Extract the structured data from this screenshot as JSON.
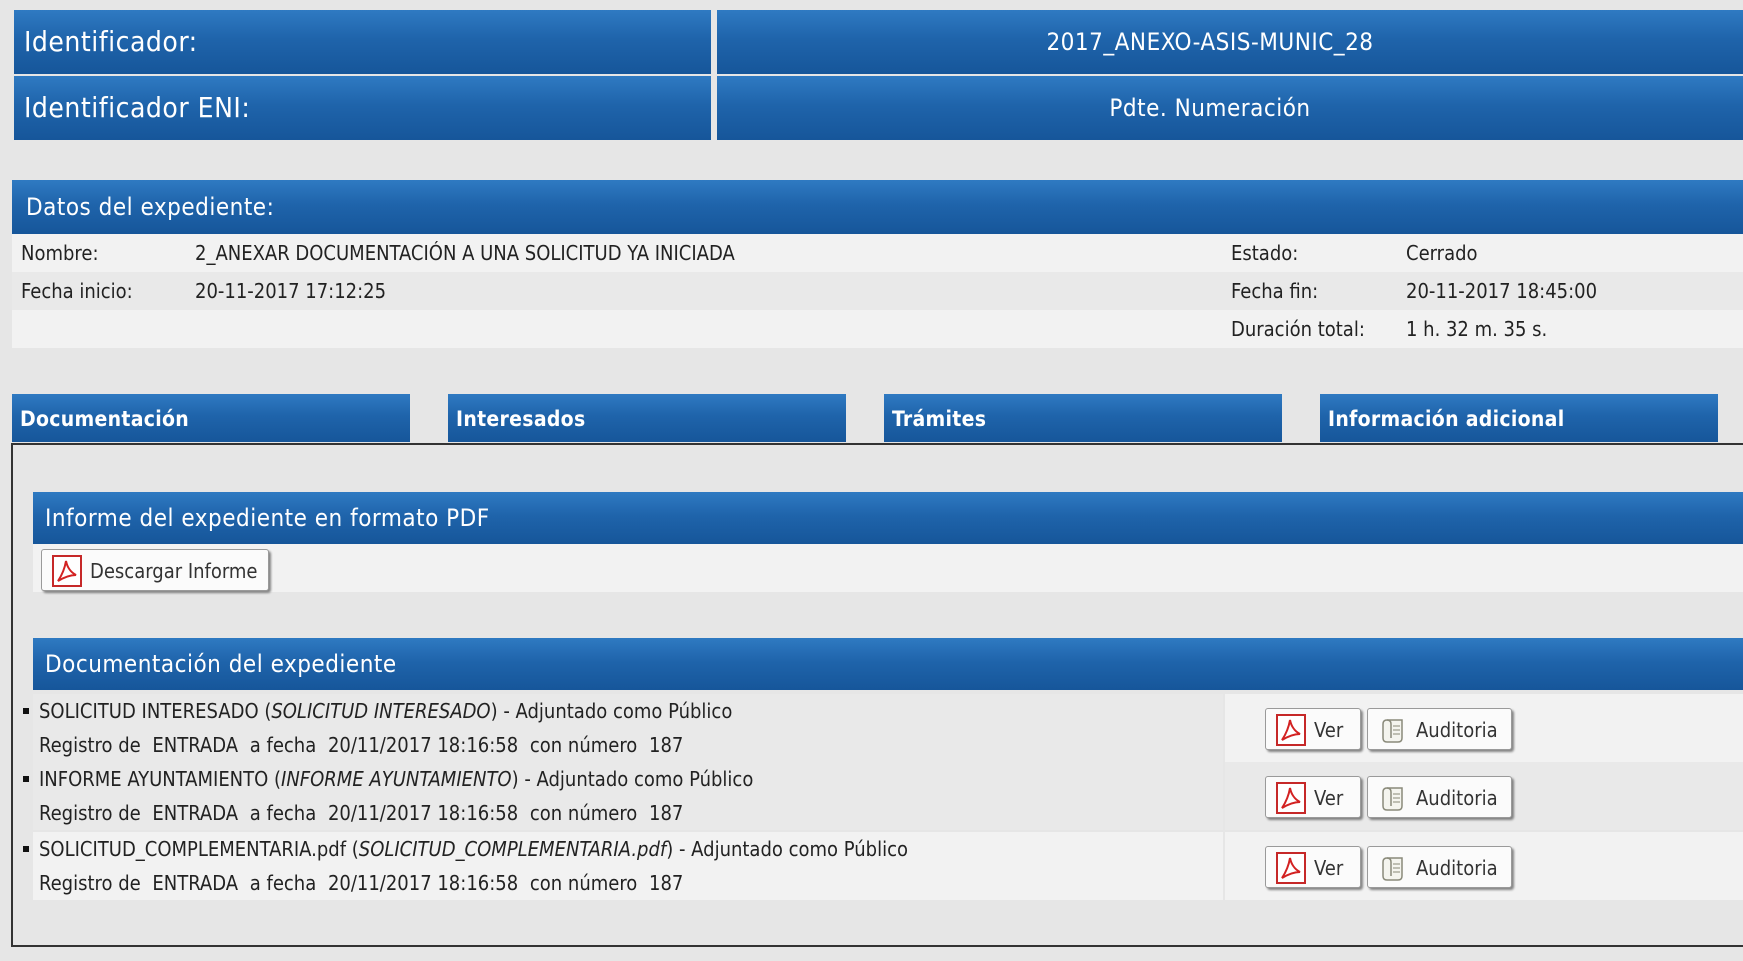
{
  "identificador": {
    "label": "Identificador:",
    "value": "2017_ANEXO-ASIS-MUNIC_28"
  },
  "identificador_eni": {
    "label": "Identificador ENI:",
    "value": "Pdte. Numeración"
  },
  "datos": {
    "title": "Datos del expediente:",
    "nombre_label": "Nombre:",
    "nombre_value": "2_ANEXAR DOCUMENTACIÓN A UNA SOLICITUD YA INICIADA",
    "estado_label": "Estado:",
    "estado_value": "Cerrado",
    "fecha_inicio_label": "Fecha inicio:",
    "fecha_inicio_value": "20-11-2017 17:12:25",
    "fecha_fin_label": "Fecha fin:",
    "fecha_fin_value": "20-11-2017 18:45:00",
    "duracion_label": "Duración total:",
    "duracion_value": "1 h. 32 m. 35 s."
  },
  "tabs": [
    {
      "label": "Documentación"
    },
    {
      "label": "Interesados"
    },
    {
      "label": "Trámites"
    },
    {
      "label": "Información adicional"
    }
  ],
  "informe": {
    "title": "Informe del expediente en formato PDF",
    "download_label": "Descargar Informe"
  },
  "documentacion": {
    "title": "Documentación del expediente",
    "ver_label": "Ver",
    "auditoria_label": "Auditoria",
    "items": [
      {
        "name": "SOLICITUD INTERESADO",
        "type": "SOLICITUD INTERESADO",
        "suffix": " - Adjuntado como Público",
        "registro": "Registro de",
        "tipo": "ENTRADA",
        "fecha_prefix": "a fecha",
        "fecha": "20/11/2017 18:16:58",
        "numero_prefix": "con número",
        "numero": "187"
      },
      {
        "name": "INFORME AYUNTAMIENTO",
        "type": "INFORME AYUNTAMIENTO",
        "suffix": " - Adjuntado como Público",
        "registro": "Registro de",
        "tipo": "ENTRADA",
        "fecha_prefix": "a fecha",
        "fecha": "20/11/2017 18:16:58",
        "numero_prefix": "con número",
        "numero": "187"
      },
      {
        "name": "SOLICITUD_COMPLEMENTARIA.pdf",
        "type": "SOLICITUD_COMPLEMENTARIA.pdf",
        "suffix": " - Adjuntado como Público",
        "registro": "Registro de",
        "tipo": "ENTRADA",
        "fecha_prefix": "a fecha",
        "fecha": "20/11/2017 18:16:58",
        "numero_prefix": "con número",
        "numero": "187"
      }
    ]
  },
  "icons": {
    "pdf": "pdf-icon",
    "auditoria": "scroll-icon"
  },
  "colors": {
    "header_blue": "#1f64ab",
    "pdf_red": "#d32222"
  }
}
